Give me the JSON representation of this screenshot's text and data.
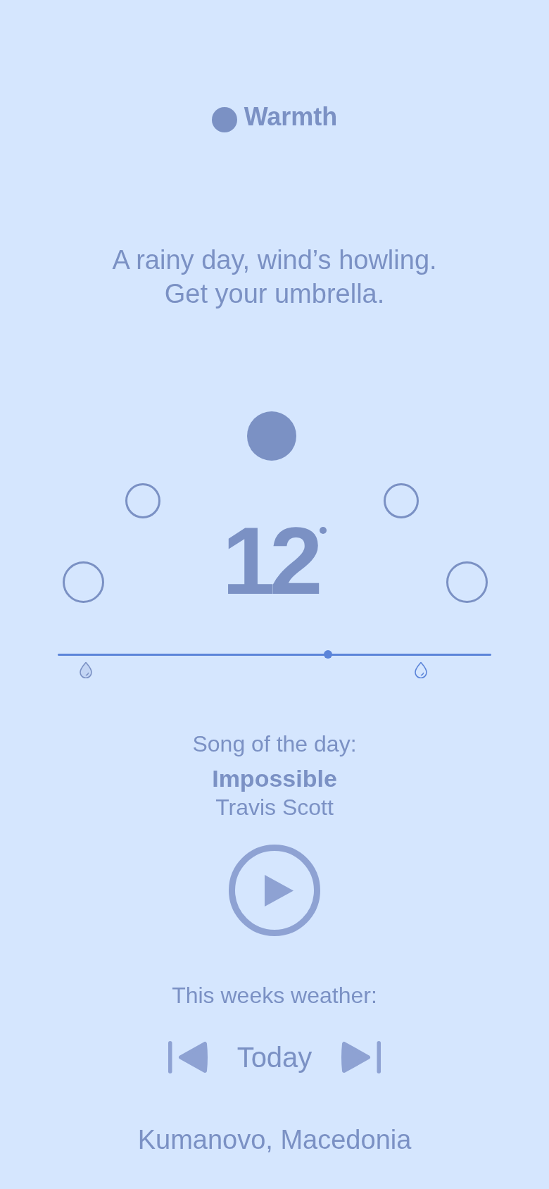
{
  "header": {
    "title": "Warmth"
  },
  "summary": "A rainy day, wind’s howling. Get your umbrella.",
  "dial": {
    "points": [
      {
        "selected": false
      },
      {
        "selected": false
      },
      {
        "selected": true
      },
      {
        "selected": false
      },
      {
        "selected": false
      }
    ],
    "temperature": "12"
  },
  "timeline": {
    "level": 0.623
  },
  "song": {
    "label": "Song of the day:",
    "title": "Impossible",
    "artist": "Travis Scott"
  },
  "week": {
    "label": "This weeks weather:",
    "day": "Today"
  },
  "location": "Kumanovo, Macedonia"
}
